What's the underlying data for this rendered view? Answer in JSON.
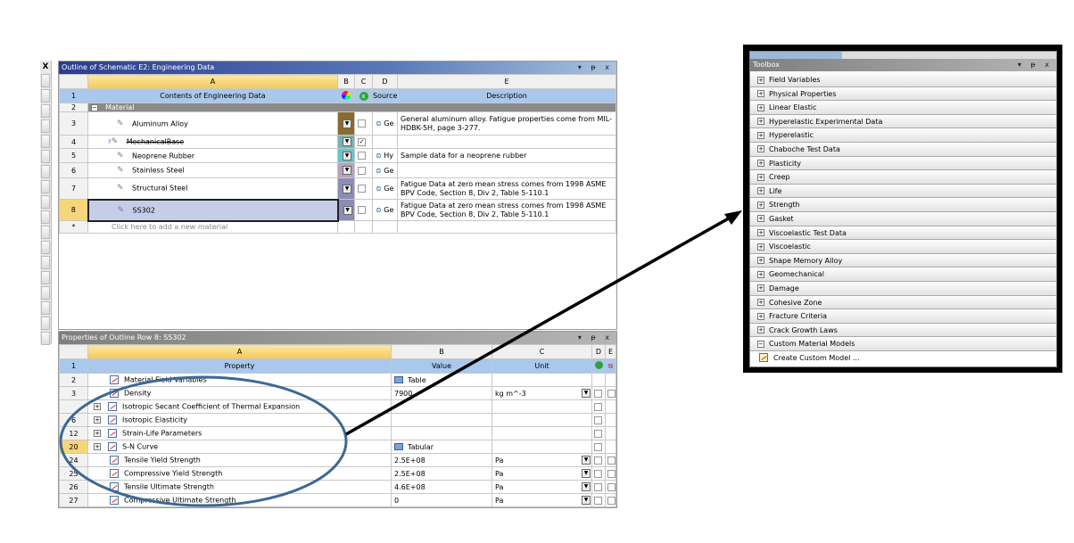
{
  "left_strip": {
    "close": "X"
  },
  "outline": {
    "title": "Outline of Schematic E2: Engineering Data",
    "controls": "▾ ᵽ x",
    "columns": [
      "A",
      "B",
      "C",
      "D",
      "E"
    ],
    "header": {
      "contents": "Contents of Engineering Data",
      "source": "Source",
      "description": "Description"
    },
    "group": "Material",
    "rows": [
      {
        "n": "3",
        "name": "Aluminum Alloy",
        "color": "#8b6a2e",
        "checked": false,
        "source": "Ge",
        "desc": "General aluminum alloy. Fatigue properties come from MIL-HDBK-5H, page 3-277."
      },
      {
        "n": "4",
        "name": "MechanicalBase",
        "color": "#79b3b0",
        "checked": true,
        "source": "",
        "desc": "",
        "strike": true
      },
      {
        "n": "5",
        "name": "Neoprene Rubber",
        "color": "#5fc7cf",
        "checked": false,
        "source": "Hy",
        "desc": "Sample data for a neoprene rubber"
      },
      {
        "n": "6",
        "name": "Stainless Steel",
        "color": "#b8a1b8",
        "checked": false,
        "source": "Ge",
        "desc": ""
      },
      {
        "n": "7",
        "name": "Structural Steel",
        "color": "#8c8cb8",
        "checked": false,
        "source": "Ge",
        "desc": "Fatigue Data at zero mean stress comes from 1998 ASME BPV Code, Section 8, Div 2, Table 5-110.1"
      },
      {
        "n": "8",
        "name": "SS302",
        "color": "#8c8cb8",
        "checked": false,
        "source": "Ge",
        "desc": "Fatigue Data at zero mean stress comes from 1998 ASME BPV Code, Section 8, Div 2, Table 5-110.1"
      }
    ],
    "new_row": {
      "n": "*",
      "placeholder": "Click here to add a new material"
    }
  },
  "properties": {
    "title": "Properties of Outline Row 8: SS302",
    "controls": "▾ ᵽ x",
    "columns": [
      "A",
      "B",
      "C",
      "D",
      "E"
    ],
    "header": {
      "property": "Property",
      "value": "Value",
      "unit": "Unit"
    },
    "rows": [
      {
        "n": "2",
        "name": "Material Field Variables",
        "value": "Table",
        "unit": ""
      },
      {
        "n": "3",
        "name": "Density",
        "value": "7900",
        "unit": "kg m^-3"
      },
      {
        "n": "",
        "name": "Isotropic Secant Coefficient of Thermal Expansion",
        "value": "",
        "unit": ""
      },
      {
        "n": "6",
        "name": "Isotropic Elasticity",
        "value": "",
        "unit": ""
      },
      {
        "n": "12",
        "name": "Strain-Life Parameters",
        "value": "",
        "unit": ""
      },
      {
        "n": "20",
        "name": "S-N Curve",
        "value": "Tabular",
        "unit": ""
      },
      {
        "n": "24",
        "name": "Tensile Yield Strength",
        "value": "2.5E+08",
        "unit": "Pa"
      },
      {
        "n": "25",
        "name": "Compressive Yield Strength",
        "value": "2.5E+08",
        "unit": "Pa"
      },
      {
        "n": "26",
        "name": "Tensile Ultimate Strength",
        "value": "4.6E+08",
        "unit": "Pa"
      },
      {
        "n": "27",
        "name": "Compressive Ultimate Strength",
        "value": "0",
        "unit": "Pa"
      }
    ]
  },
  "toolbox": {
    "title": "Toolbox",
    "controls": "▾ ᵽ x",
    "items": [
      "Field Variables",
      "Physical Properties",
      "Linear Elastic",
      "Hyperelastic Experimental Data",
      "Hyperelastic",
      "Chaboche Test Data",
      "Plasticity",
      "Creep",
      "Life",
      "Strength",
      "Gasket",
      "Viscoelastic Test Data",
      "Viscoelastic",
      "Shape Memory Alloy",
      "Geomechanical",
      "Damage",
      "Cohesive Zone",
      "Fracture Criteria",
      "Crack Growth Laws",
      "Custom Material Models"
    ],
    "create": "Create Custom Model ..."
  },
  "annotation": {
    "ellipse_color": "#3d6894",
    "arrow_color": "#000000"
  }
}
